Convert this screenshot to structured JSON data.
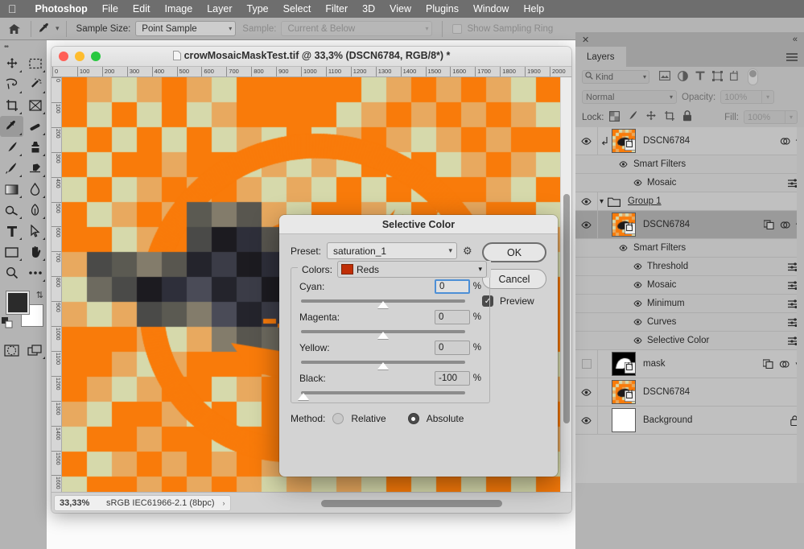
{
  "menubar": {
    "apple_icon": "apple-logo",
    "items": [
      {
        "label": "Photoshop",
        "bold": true
      },
      {
        "label": "File",
        "bold": false
      },
      {
        "label": "Edit",
        "bold": false
      },
      {
        "label": "Image",
        "bold": false
      },
      {
        "label": "Layer",
        "bold": false
      },
      {
        "label": "Type",
        "bold": false
      },
      {
        "label": "Select",
        "bold": false
      },
      {
        "label": "Filter",
        "bold": false
      },
      {
        "label": "3D",
        "bold": false
      },
      {
        "label": "View",
        "bold": false
      },
      {
        "label": "Plugins",
        "bold": false
      },
      {
        "label": "Window",
        "bold": false
      },
      {
        "label": "Help",
        "bold": false
      }
    ]
  },
  "options_bar": {
    "home_icon": "home-icon",
    "tool_icon": "eyedropper-icon",
    "sample_size_label": "Sample Size:",
    "sample_size_value": "Point Sample",
    "sample_label": "Sample:",
    "sample_value": "Current & Below",
    "show_sampling_ring_label": "Show Sampling Ring",
    "show_sampling_ring_checked": false
  },
  "toolbar": {
    "tools": [
      {
        "name": "move-tool",
        "icon": "move-icon"
      },
      {
        "name": "rectangular-marquee-tool",
        "icon": "marquee-icon"
      },
      {
        "name": "lasso-tool",
        "icon": "lasso-icon"
      },
      {
        "name": "quick-selection-tool",
        "icon": "magic-wand-icon"
      },
      {
        "name": "crop-tool",
        "icon": "crop-icon"
      },
      {
        "name": "frame-tool",
        "icon": "frame-icon"
      },
      {
        "name": "eyedropper-tool",
        "icon": "eyedropper-icon",
        "selected": true
      },
      {
        "name": "healing-brush-tool",
        "icon": "healing-brush-icon"
      },
      {
        "name": "brush-tool",
        "icon": "brush-icon"
      },
      {
        "name": "clone-stamp-tool",
        "icon": "stamp-icon"
      },
      {
        "name": "history-brush-tool",
        "icon": "history-brush-icon"
      },
      {
        "name": "eraser-tool",
        "icon": "eraser-icon"
      },
      {
        "name": "gradient-tool",
        "icon": "gradient-icon"
      },
      {
        "name": "blur-tool",
        "icon": "blur-drop-icon"
      },
      {
        "name": "dodge-tool",
        "icon": "dodge-icon"
      },
      {
        "name": "pen-tool",
        "icon": "pen-icon"
      },
      {
        "name": "type-tool",
        "icon": "type-t-icon"
      },
      {
        "name": "path-selection-tool",
        "icon": "arrow-cursor-icon"
      },
      {
        "name": "rectangle-tool",
        "icon": "rectangle-icon"
      },
      {
        "name": "hand-tool",
        "icon": "hand-icon"
      },
      {
        "name": "zoom-tool",
        "icon": "magnifier-icon"
      },
      {
        "name": "more-tools",
        "icon": "ellipsis-icon"
      }
    ],
    "foreground_color": "#2b2b2b",
    "background_color": "#ffffff",
    "swap_icon": "swap-colors-icon",
    "default_icon": "default-colors-icon",
    "quick_mask_icon": "quick-mask-icon",
    "screen_mode_icon": "screen-mode-icon"
  },
  "document": {
    "title": "crowMosaicMaskTest.tif @ 33,3% (DSCN6784, RGB/8*) *",
    "doc_icon": "document-icon",
    "traffic_lights": [
      "close",
      "minimize",
      "maximize"
    ],
    "ruler_unit_max": 2000,
    "ruler_ticks": [
      "0",
      "100",
      "200",
      "300",
      "400",
      "500",
      "600",
      "700",
      "800",
      "900",
      "1000",
      "1100",
      "1200",
      "1300",
      "1400",
      "1500",
      "1600",
      "1700",
      "1800",
      "1900",
      "2000"
    ],
    "status_zoom": "33,33%",
    "status_profile": "sRGB IEC61966-2.1 (8bpc)",
    "status_arrow": "›"
  },
  "layers_panel": {
    "close_icon": "close-icon",
    "collapse_icon": "collapse-panel-icon",
    "tab_label": "Layers",
    "menu_icon": "panel-menu-icon",
    "filter_kind_label": "Kind",
    "search_icon": "search-icon",
    "filter_icons": [
      "image-filter-icon",
      "adjustment-filter-icon",
      "type-filter-icon",
      "shape-filter-icon",
      "smart-object-filter-icon"
    ],
    "filter_toggle": "filter-toggle",
    "blend_mode": "Normal",
    "opacity_label": "Opacity:",
    "opacity_value": "100%",
    "lock_label": "Lock:",
    "lock_icons": [
      "lock-transparency-icon",
      "lock-image-icon",
      "lock-position-icon",
      "lock-artboard-icon",
      "lock-all-icon"
    ],
    "fill_label": "Fill:",
    "fill_value": "100%",
    "rows": [
      {
        "name": "DSCN6784",
        "type": "smart-object",
        "indent": 0,
        "visible": true,
        "selected": false,
        "clipped": true,
        "thumb": "crow-mosaic",
        "right_icons": [
          "fx-adjust-icon",
          "expand-chevron-icon"
        ],
        "height": "tall"
      },
      {
        "name": "Smart Filters",
        "type": "smart-filters",
        "indent": 1,
        "visible": true,
        "selected": false,
        "thumb": null,
        "right_icons": []
      },
      {
        "name": "Mosaic",
        "type": "filter",
        "indent": 2,
        "visible": true,
        "selected": false,
        "thumb": null,
        "right_icons": [
          "filter-settings-icon"
        ]
      },
      {
        "name": "Group 1",
        "type": "group",
        "indent": 0,
        "visible": true,
        "selected": false,
        "thumb": "folder",
        "right_icons": []
      },
      {
        "name": "DSCN6784",
        "type": "smart-object",
        "indent": 0,
        "visible": true,
        "selected": true,
        "clipped": false,
        "thumb": "crow-mosaic",
        "right_icons": [
          "mask-link-icon",
          "fx-adjust-icon",
          "expand-chevron-icon"
        ],
        "height": "tall"
      },
      {
        "name": "Smart Filters",
        "type": "smart-filters",
        "indent": 1,
        "visible": true,
        "selected": false,
        "thumb": null,
        "right_icons": []
      },
      {
        "name": "Threshold",
        "type": "filter",
        "indent": 2,
        "visible": true,
        "selected": false,
        "thumb": null,
        "right_icons": [
          "filter-settings-icon"
        ]
      },
      {
        "name": "Mosaic",
        "type": "filter",
        "indent": 2,
        "visible": true,
        "selected": false,
        "thumb": null,
        "right_icons": [
          "filter-settings-icon"
        ]
      },
      {
        "name": "Minimum",
        "type": "filter",
        "indent": 2,
        "visible": true,
        "selected": false,
        "thumb": null,
        "right_icons": [
          "filter-settings-icon"
        ]
      },
      {
        "name": "Curves",
        "type": "filter",
        "indent": 2,
        "visible": true,
        "selected": false,
        "thumb": null,
        "right_icons": [
          "filter-settings-icon"
        ]
      },
      {
        "name": "Selective Color",
        "type": "filter",
        "indent": 2,
        "visible": true,
        "selected": false,
        "thumb": null,
        "right_icons": [
          "filter-settings-icon"
        ]
      },
      {
        "name": "mask",
        "type": "smart-object",
        "indent": 0,
        "visible": false,
        "selected": false,
        "thumb": "mask-bw",
        "right_icons": [
          "mask-link-icon",
          "fx-adjust-icon",
          "collapse-chevron-icon"
        ],
        "height": "tall"
      },
      {
        "name": "DSCN6784",
        "type": "smart-object",
        "indent": 0,
        "visible": true,
        "selected": false,
        "thumb": "crow-mosaic",
        "right_icons": [],
        "height": "tall"
      },
      {
        "name": "Background",
        "type": "raster",
        "indent": 0,
        "visible": true,
        "selected": false,
        "thumb": "white",
        "right_icons": [
          "lock-icon"
        ],
        "height": "tall"
      }
    ]
  },
  "dialog": {
    "title": "Selective Color",
    "preset_label": "Preset:",
    "preset_value": "saturation_1",
    "gear_icon": "preset-options-gear-icon",
    "ok_label": "OK",
    "cancel_label": "Cancel",
    "preview_label": "Preview",
    "preview_checked": true,
    "colors_label": "Colors:",
    "colors_value": "Reds",
    "colors_swatch": "#c02e06",
    "sliders": [
      {
        "label": "Cyan:",
        "value": "0",
        "unit": "%",
        "pos": 50,
        "active": true
      },
      {
        "label": "Magenta:",
        "value": "0",
        "unit": "%",
        "pos": 50,
        "active": false
      },
      {
        "label": "Yellow:",
        "value": "0",
        "unit": "%",
        "pos": 50,
        "active": false
      },
      {
        "label": "Black:",
        "value": "-100",
        "unit": "%",
        "pos": 0,
        "active": false
      }
    ],
    "method_label": "Method:",
    "method_options": [
      {
        "label": "Relative",
        "selected": false
      },
      {
        "label": "Absolute",
        "selected": true
      }
    ]
  },
  "colors": {
    "orange": "#f97b0a",
    "cream": "#d6d9ab",
    "tan": "#e8a95f",
    "menubar_bg": "#6e6e6e",
    "panel_bg": "#b4b4b4",
    "accent_blue": "#4d8fd6"
  }
}
